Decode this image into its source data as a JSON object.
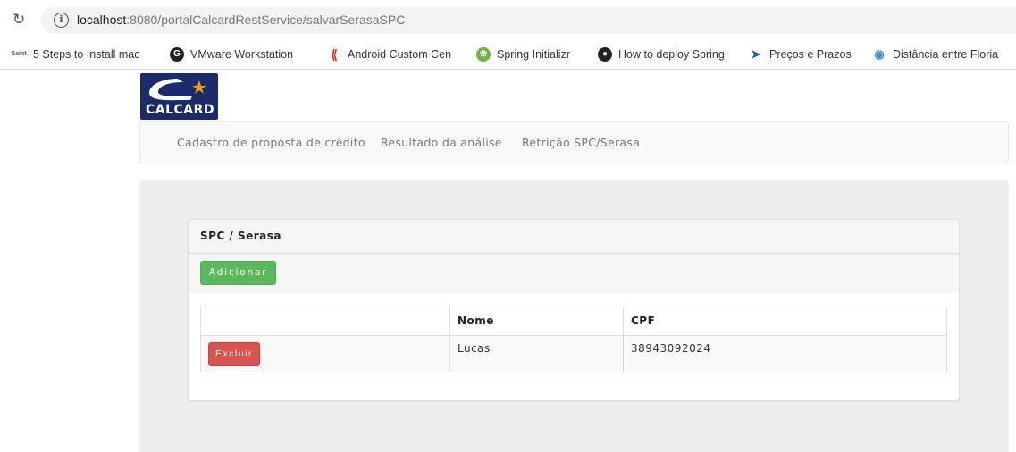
{
  "browser": {
    "url_host": "localhost",
    "url_rest": ":8080/portalCalcardRestService/salvarSerasaSPC",
    "bookmarks": [
      {
        "label": "5 Steps to Install mac",
        "icon": "saint-favicon"
      },
      {
        "label": "VMware Workstation",
        "icon": "google-favicon"
      },
      {
        "label": "Android Custom Cen",
        "icon": "android-favicon"
      },
      {
        "label": "Spring Initializr",
        "icon": "spring-favicon"
      },
      {
        "label": "How to deploy Spring",
        "icon": "github-favicon"
      },
      {
        "label": "Preços e Prazos",
        "icon": "correios-favicon"
      },
      {
        "label": "Distância entre Floria",
        "icon": "map-pin-favicon"
      }
    ]
  },
  "logo": {
    "text": "CALCARD"
  },
  "nav": {
    "items": [
      "Cadastro de proposta de crédito",
      "Resultado da análise",
      "Retrição SPC/Serasa"
    ]
  },
  "panel": {
    "title": "SPC / Serasa",
    "add_label": "Adicionar"
  },
  "table": {
    "headers": [
      "",
      "Nome",
      "CPF"
    ],
    "rows": [
      {
        "delete_label": "Excluir",
        "nome": "Lucas",
        "cpf": "38943092024"
      }
    ]
  },
  "colors": {
    "success": "#5cb85c",
    "danger": "#d9534f",
    "brand": "#1b2a6b",
    "accent_star": "#f39c12"
  }
}
